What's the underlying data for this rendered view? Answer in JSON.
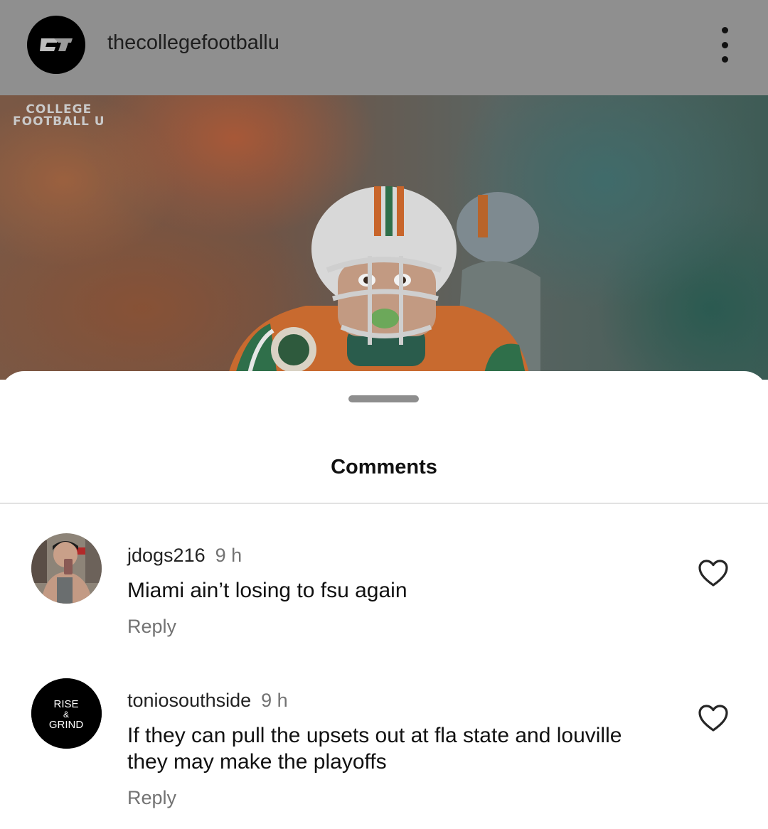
{
  "post": {
    "username": "thecollegefootballu",
    "watermark_line1": "COLLEGE",
    "watermark_line2": "FOOTBALL U"
  },
  "sheet": {
    "title": "Comments"
  },
  "comments": [
    {
      "username": "jdogs216",
      "time": "9 h",
      "text": "Miami ain’t losing to fsu again",
      "reply_label": "Reply"
    },
    {
      "username": "toniosouthside",
      "time": "9 h",
      "text": "If they can pull the upsets out at fla state and louville they may make the playoffs",
      "reply_label": "Reply",
      "avatar_text": [
        "RISE",
        "&",
        "GRIND"
      ]
    }
  ],
  "colors": {
    "header_dim": "#8f8f8f",
    "miami_orange": "#f47321",
    "miami_green": "#005030",
    "secondary_text": "#737373"
  }
}
